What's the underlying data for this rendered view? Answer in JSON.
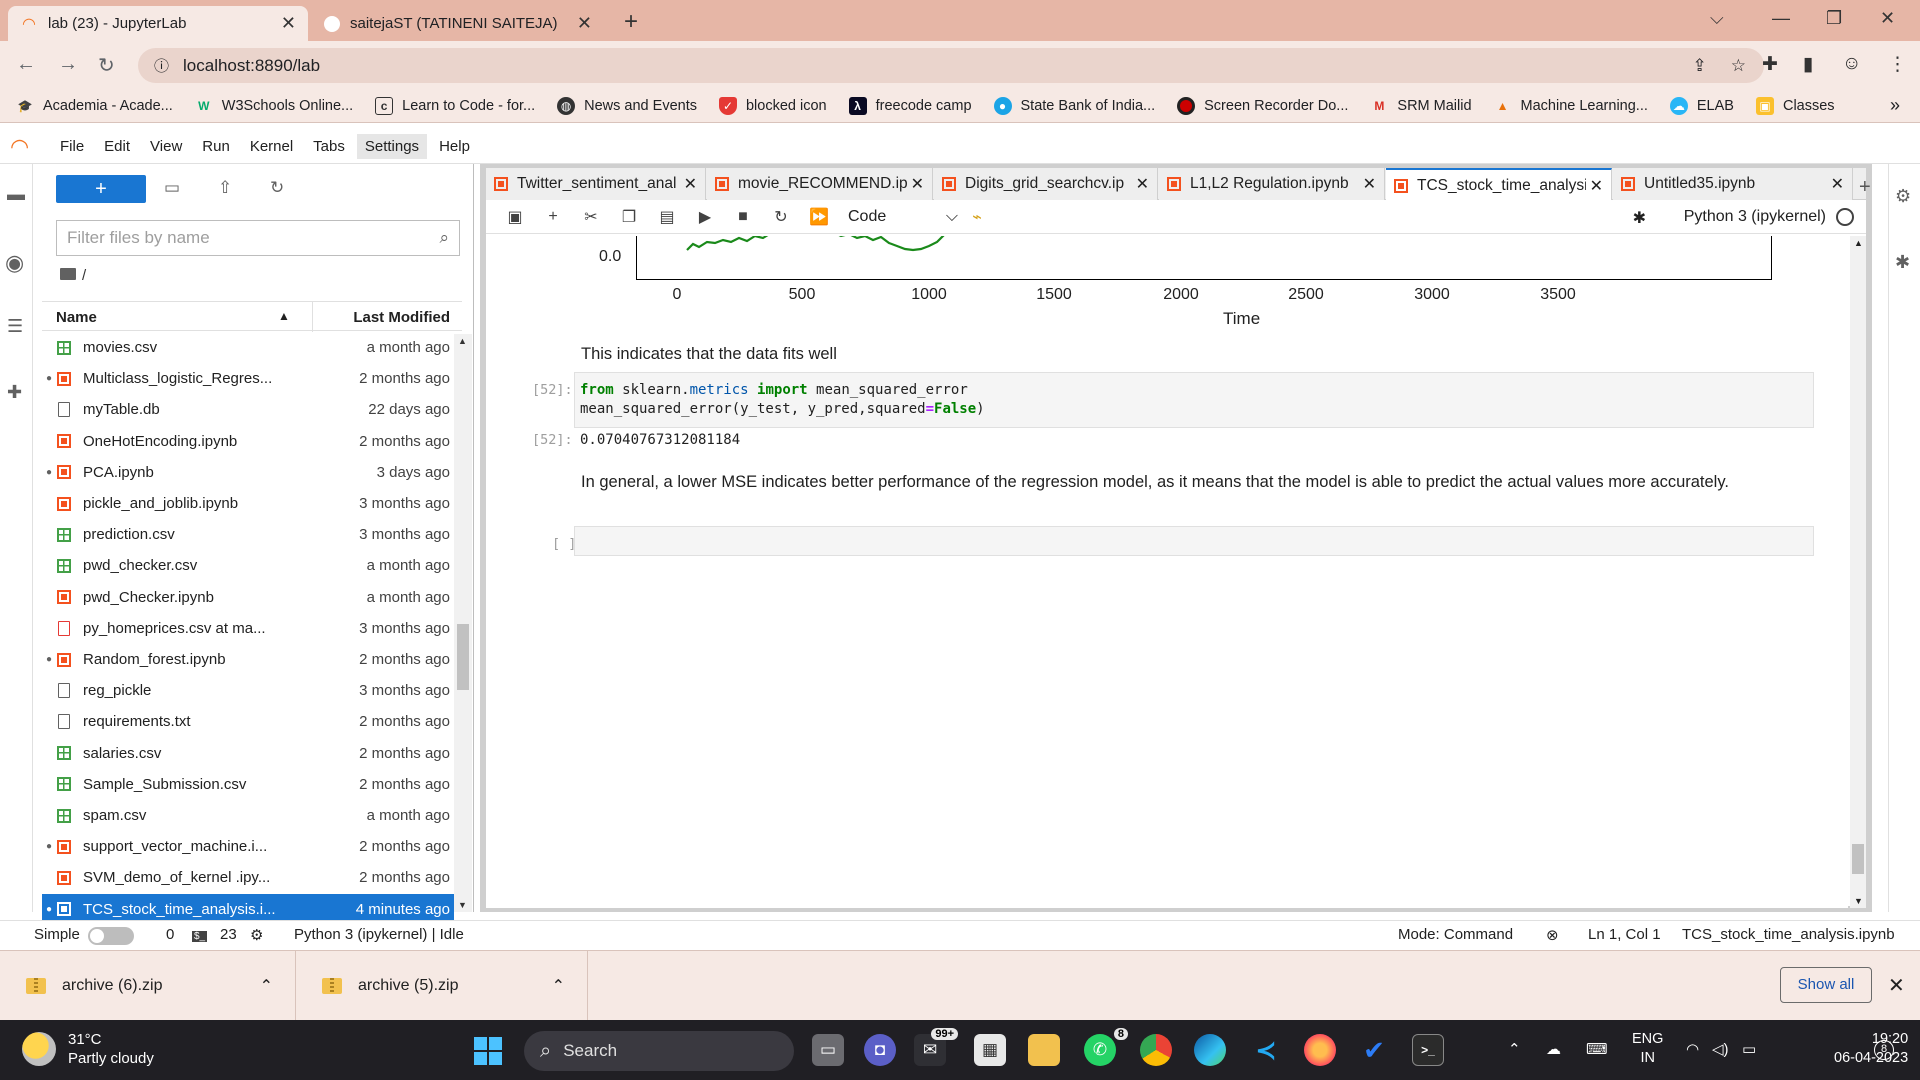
{
  "browser": {
    "tabs": [
      {
        "title": "lab (23) - JupyterLab",
        "active": true
      },
      {
        "title": "saitejaST (TATINENI SAITEJA)",
        "active": false
      }
    ],
    "url": "localhost:8890/lab",
    "bookmarks": [
      "Academia - Acade...",
      "W3Schools Online...",
      "Learn to Code - for...",
      "News and Events",
      "blocked icon",
      "freecode camp",
      "State Bank of India...",
      "Screen Recorder Do...",
      "SRM Mailid",
      "Machine Learning...",
      "ELAB",
      "Classes"
    ]
  },
  "menu": [
    "File",
    "Edit",
    "View",
    "Run",
    "Kernel",
    "Tabs",
    "Settings",
    "Help"
  ],
  "filebrowser": {
    "new_label": "+",
    "filter_placeholder": "Filter files by name",
    "path": "/",
    "col_name": "Name",
    "col_modified": "Last Modified",
    "files": [
      {
        "name": "movies.csv",
        "modified": "a month ago",
        "type": "csv",
        "running": false
      },
      {
        "name": "Multiclass_logistic_Regres...",
        "modified": "2 months ago",
        "type": "notebook",
        "running": true
      },
      {
        "name": "myTable.db",
        "modified": "22 days ago",
        "type": "file",
        "running": false
      },
      {
        "name": "OneHotEncoding.ipynb",
        "modified": "2 months ago",
        "type": "notebook",
        "running": false
      },
      {
        "name": "PCA.ipynb",
        "modified": "3 days ago",
        "type": "notebook",
        "running": true
      },
      {
        "name": "pickle_and_joblib.ipynb",
        "modified": "3 months ago",
        "type": "notebook",
        "running": false
      },
      {
        "name": "prediction.csv",
        "modified": "3 months ago",
        "type": "csv",
        "running": false
      },
      {
        "name": "pwd_checker.csv",
        "modified": "a month ago",
        "type": "csv",
        "running": false
      },
      {
        "name": "pwd_Checker.ipynb",
        "modified": "a month ago",
        "type": "notebook",
        "running": false
      },
      {
        "name": "py_homeprices.csv at ma...",
        "modified": "3 months ago",
        "type": "html",
        "running": false
      },
      {
        "name": "Random_forest.ipynb",
        "modified": "2 months ago",
        "type": "notebook",
        "running": true
      },
      {
        "name": "reg_pickle",
        "modified": "3 months ago",
        "type": "file",
        "running": false
      },
      {
        "name": "requirements.txt",
        "modified": "2 months ago",
        "type": "file",
        "running": false
      },
      {
        "name": "salaries.csv",
        "modified": "2 months ago",
        "type": "csv",
        "running": false
      },
      {
        "name": "Sample_Submission.csv",
        "modified": "2 months ago",
        "type": "csv",
        "running": false
      },
      {
        "name": "spam.csv",
        "modified": "a month ago",
        "type": "csv",
        "running": false
      },
      {
        "name": "support_vector_machine.i...",
        "modified": "2 months ago",
        "type": "notebook",
        "running": true
      },
      {
        "name": "SVM_demo_of_kernel .ipy...",
        "modified": "2 months ago",
        "type": "notebook",
        "running": false
      },
      {
        "name": "TCS_stock_time_analysis.i...",
        "modified": "4 minutes ago",
        "type": "notebook",
        "running": true,
        "selected": true
      }
    ]
  },
  "notebook_tabs": [
    {
      "title": "Twitter_sentiment_anal",
      "active": false
    },
    {
      "title": "movie_RECOMMEND.ip",
      "active": false
    },
    {
      "title": "Digits_grid_searchcv.ip",
      "active": false
    },
    {
      "title": "L1,L2 Regulation.ipynb",
      "active": false
    },
    {
      "title": "TCS_stock_time_analysi",
      "active": true
    },
    {
      "title": "Untitled35.ipynb",
      "active": false
    }
  ],
  "notebook_toolbar": {
    "cell_type": "Code",
    "kernel": "Python 3 (ipykernel)"
  },
  "plot": {
    "ytick": "0.0",
    "xticks": [
      "0",
      "500",
      "1000",
      "1500",
      "2000",
      "2500",
      "3000",
      "3500"
    ],
    "xlabel": "Time",
    "line_color": "#1a8a1a"
  },
  "cells": {
    "md1": "This indicates that the data fits well",
    "code_prompt": "[52]:",
    "out_prompt": "[52]:",
    "output": "0.07040767312081184",
    "md2": "In general, a lower MSE indicates better performance of the regression model, as it means that the model is able to predict the actual values more accurately.",
    "empty_prompt": "[ ]:"
  },
  "statusbar": {
    "mode_label": "Simple",
    "terminals": "0",
    "kernels": "23",
    "kernel_status": "Python 3 (ipykernel) | Idle",
    "mode": "Mode: Command",
    "position": "Ln 1, Col 1",
    "filename": "TCS_stock_time_analysis.ipynb"
  },
  "downloads": [
    {
      "name": "archive (6).zip"
    },
    {
      "name": "archive (5).zip"
    }
  ],
  "downloads_show_all": "Show all",
  "taskbar": {
    "temp": "31°C",
    "weather": "Partly cloudy",
    "search": "Search",
    "mail_badge": "99+",
    "whatsapp_badge": "8",
    "lang1": "ENG",
    "lang2": "IN",
    "time": "19:20",
    "date": "06-04-2023",
    "notifications": "8"
  }
}
